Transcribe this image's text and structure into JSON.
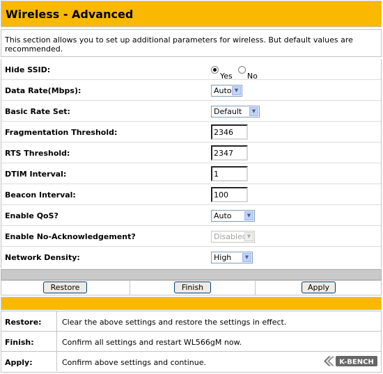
{
  "page": {
    "title": "Wireless - Advanced",
    "intro": "This section allows you to set up additional parameters for wireless. But default values are recommended."
  },
  "settings": {
    "hide_ssid": {
      "label": "Hide SSID:",
      "options": [
        "Yes",
        "No"
      ],
      "selected": "Yes"
    },
    "data_rate": {
      "label": "Data Rate(Mbps):",
      "value": "Auto"
    },
    "basic_rate_set": {
      "label": "Basic Rate Set:",
      "value": "Default"
    },
    "fragmentation_threshold": {
      "label": "Fragmentation Threshold:",
      "value": "2346"
    },
    "rts_threshold": {
      "label": "RTS Threshold:",
      "value": "2347"
    },
    "dtim_interval": {
      "label": "DTIM Interval:",
      "value": "1"
    },
    "beacon_interval": {
      "label": "Beacon Interval:",
      "value": "100"
    },
    "enable_qos": {
      "label": "Enable QoS?",
      "value": "Auto"
    },
    "enable_no_ack": {
      "label": "Enable No-Acknowledgement?",
      "value": "Disabled",
      "disabled": true
    },
    "network_density": {
      "label": "Network Density:",
      "value": "High"
    }
  },
  "buttons": {
    "restore": "Restore",
    "finish": "Finish",
    "apply": "Apply"
  },
  "help": [
    {
      "label": "Restore:",
      "text": "Clear the above settings and restore the settings in effect."
    },
    {
      "label": "Finish:",
      "text": "Confirm all settings and restart WL566gM now."
    },
    {
      "label": "Apply:",
      "text": "Confirm above settings and continue."
    }
  ],
  "logo": {
    "text": "K-BENCH",
    "icon": "kbench-logo-icon"
  },
  "colors": {
    "accent": "#fbb800",
    "border": "#c4c4c4",
    "gray_bar": "#c9c9c9"
  }
}
